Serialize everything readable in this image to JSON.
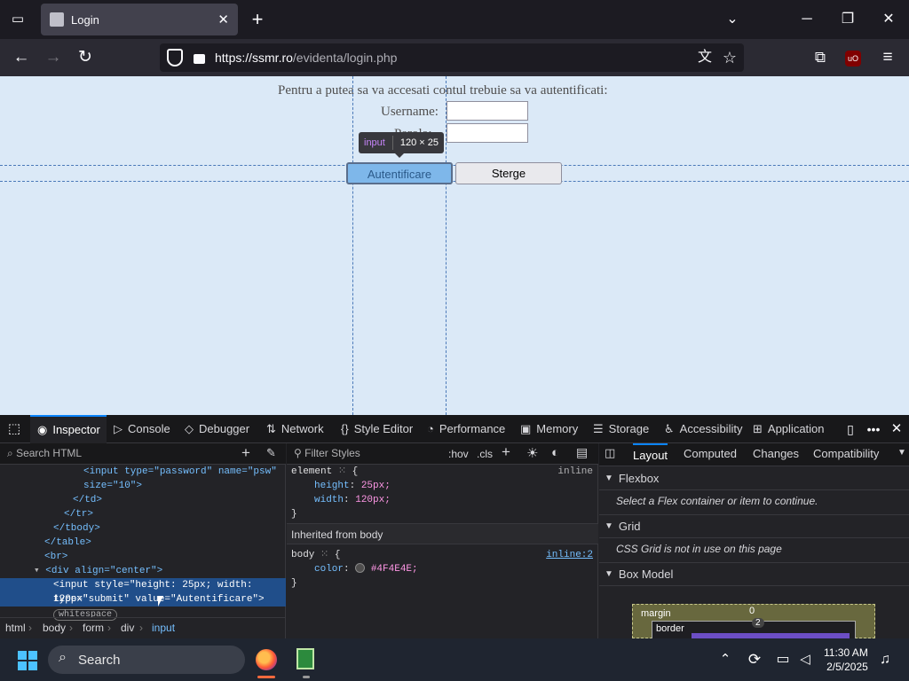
{
  "browser": {
    "tab_title": "Login",
    "url_host": "https://ssmr.ro",
    "url_path": "/evidenta/login.php"
  },
  "page": {
    "intro": "Pentru a putea sa va accesati contul trebuie sa va autentificati:",
    "username_label": "Username:",
    "password_label": "Parola:",
    "submit_label": "Autentificare",
    "reset_label": "Sterge"
  },
  "highlighter": {
    "tag": "input",
    "size": "120 × 25"
  },
  "devtools": {
    "tabs": [
      "Inspector",
      "Console",
      "Debugger",
      "Network",
      "Style Editor",
      "Performance",
      "Memory",
      "Storage",
      "Accessibility",
      "Application"
    ],
    "search_placeholder": "Search HTML",
    "filter_placeholder": "Filter Styles",
    "hov": ":hov",
    "cls": ".cls",
    "sidebar_tabs": [
      "Layout",
      "Computed",
      "Changes",
      "Compatibility"
    ],
    "html_lines": [
      "<input type=\"password\" name=\"psw\"",
      "size=\"10\">",
      "</td>",
      "</tr>",
      "</tbody>",
      "</table>",
      "<br>",
      "<div align=\"center\">",
      "<input style=\"height: 25px; width: 120px\"",
      "type=\"submit\" value=\"Autentificare\">",
      "whitespace"
    ],
    "rules": {
      "element_selector": "element",
      "element_origin": "inline",
      "height_prop": "height",
      "height_val": "25px;",
      "width_prop": "width",
      "width_val": "120px;",
      "inherited_header": "Inherited from body",
      "body_selector": "body",
      "body_origin": "inline:2",
      "color_prop": "color",
      "color_val": "#4F4E4E;"
    },
    "layout": {
      "flexbox_header": "Flexbox",
      "flexbox_msg": "Select a Flex container or item to continue.",
      "grid_header": "Grid",
      "grid_msg": "CSS Grid is not in use on this page",
      "boxmodel_header": "Box Model",
      "margin_label": "margin",
      "margin_val": "0",
      "border_label": "border",
      "border_val": "2"
    },
    "breadcrumbs": [
      "html",
      "body",
      "form",
      "div",
      "input"
    ]
  },
  "taskbar": {
    "search_label": "Search",
    "time": "11:30 AM",
    "date": "2/5/2025"
  },
  "colors": {
    "page_bg": "#dbe9f7",
    "text": "#4f4e4e",
    "accent": "#0a84ff"
  }
}
